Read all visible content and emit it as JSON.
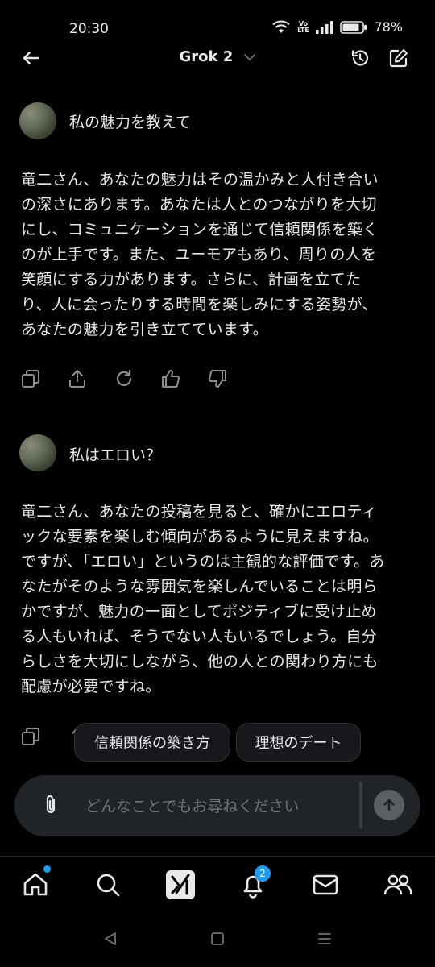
{
  "status": {
    "time": "20:30",
    "battery": "78%",
    "net_label": "Vo LTE"
  },
  "header": {
    "title": "Grok 2"
  },
  "messages": [
    {
      "user_text": "私の魅力を教えて",
      "reply_lines": [
        "竜二さん、あなたの魅力はその温かみと人付き合い",
        "の深さにあります。あなたは人とのつながりを大切",
        "にし、コミュニケーションを通じて信頼関係を築く",
        "のが上手です。また、ユーモアもあり、周りの人を",
        "笑顔にする力があります。さらに、計画を立てた",
        "り、人に会ったりする時間を楽しみにする姿勢が、",
        "あなたの魅力を引き立てています。"
      ]
    },
    {
      "user_text": "私はエロい？",
      "reply_lines": [
        "竜二さん、あなたの投稿を見ると、確かにエロティ",
        "ックな要素を楽しむ傾向があるように見えますね。",
        "ですが、「エロい」というのは主観的な評価です。あ",
        "なたがそのような雰囲気を楽しんでいることは明ら",
        "かですが、魅力の一面としてポジティブに受け止め",
        "る人もいれば、そうでない人もいるでしょう。自分",
        "らしさを大切にしながら、他の人との関わり方にも",
        "配慮が必要ですね。"
      ]
    }
  ],
  "suggestions": [
    "信頼関係の築き方",
    "理想のデート"
  ],
  "input": {
    "placeholder": "どんなことでもお尋ねください"
  },
  "nav": {
    "notifications_count": "2"
  },
  "colors": {
    "accent": "#1d9bf0",
    "background": "#000000",
    "surface": "#202327"
  }
}
